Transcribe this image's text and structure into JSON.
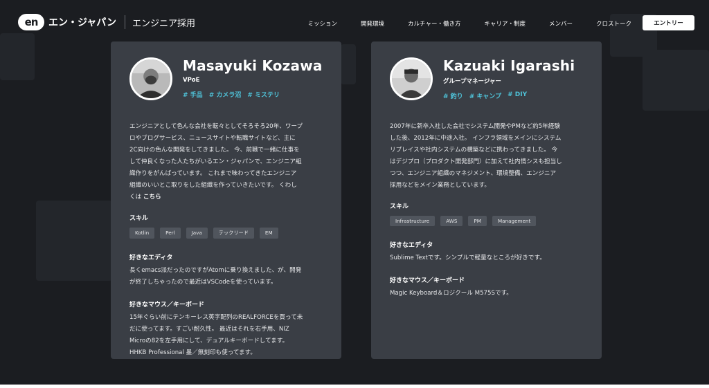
{
  "header": {
    "logo_mark": "en",
    "logo_text": "エン・ジャパン",
    "logo_sub": "エンジニア採用",
    "nav": [
      {
        "label": "ミッション"
      },
      {
        "label": "開発環境"
      },
      {
        "label": "カルチャー・働き方"
      },
      {
        "label": "キャリア・制度"
      },
      {
        "label": "メンバー"
      },
      {
        "label": "クロストーク"
      }
    ],
    "entry_label": "エントリー"
  },
  "cards": [
    {
      "name": "Masayuki Kozawa",
      "role": "VPoE",
      "tags": [
        "# 手品",
        "# カメラ沼",
        "# ミステリ"
      ],
      "bio_lines": [
        "エンジニアとして色んな会社を転々としてそろそろ20年、ワープ",
        "ロやブログサービス、ニュースサイトや転職サイトなど、主に",
        "2C向けの色んな開発をしてきました。 今、前職で一緒に仕事を",
        "して仲良くなった人たちがいるエン・ジャパンで、エンジニア組",
        "織作りをがんばっています。 これまで味わってきたエンジニア",
        "組織のいいとこ取りをした組織を作っていきたいです。 くわし"
      ],
      "bio_last_prefix": "くは ",
      "bio_link": "こちら",
      "skills_title": "スキル",
      "skills": [
        "Kotlin",
        "Perl",
        "Java",
        "テックリード",
        "EM"
      ],
      "editor_title": "好きなエディタ",
      "editor_lines": [
        "長くemacs派だったのですがAtomに乗り換えました、が、開発",
        "が終了しちゃったので最近はVSCodeを使っています。"
      ],
      "mouse_title": "好きなマウス／キーボード",
      "mouse_lines": [
        "15年ぐらい前にテンキーレス英字配列のREALFORCEを買って未",
        "だに使ってます。すごい耐久性。 最近はそれを右手用、NIZ",
        "Microの82を左手用にして、デュアルキーボードしてます。",
        "HHKB Professional 墨／無刻印も使ってます。"
      ]
    },
    {
      "name": "Kazuaki Igarashi",
      "role": "グループマネージャー",
      "tags": [
        "# 釣り",
        "# キャンプ",
        "# DIY"
      ],
      "bio_lines": [
        "2007年に新卒入社した会社でシステム開発やPMなど約5年経験",
        "した後、2012年に中途入社。 インフラ領域をメインにシステム",
        "リプレイスや社内システムの構築などに携わってきました。 今",
        "はデジプロ（プロダクト開発部門）に加えて社内情シスも担当し",
        "つつ、エンジニア組織のマネジメント、環境整備、エンジニア",
        "採用などをメイン業務としています。"
      ],
      "skills_title": "スキル",
      "skills": [
        "Infrastructure",
        "AWS",
        "PM",
        "Management"
      ],
      "editor_title": "好きなエディタ",
      "editor_lines": [
        "Sublime Textです。シンプルで軽量なところが好きです。"
      ],
      "mouse_title": "好きなマウス／キーボード",
      "mouse_lines": [
        "Magic Keyboard＆ロジクール M575Sです。"
      ]
    }
  ],
  "colors": {
    "background": "#1b1d21",
    "card": "#3a3e45",
    "accent": "#4fc3d9",
    "skill_chip": "#50555d"
  }
}
